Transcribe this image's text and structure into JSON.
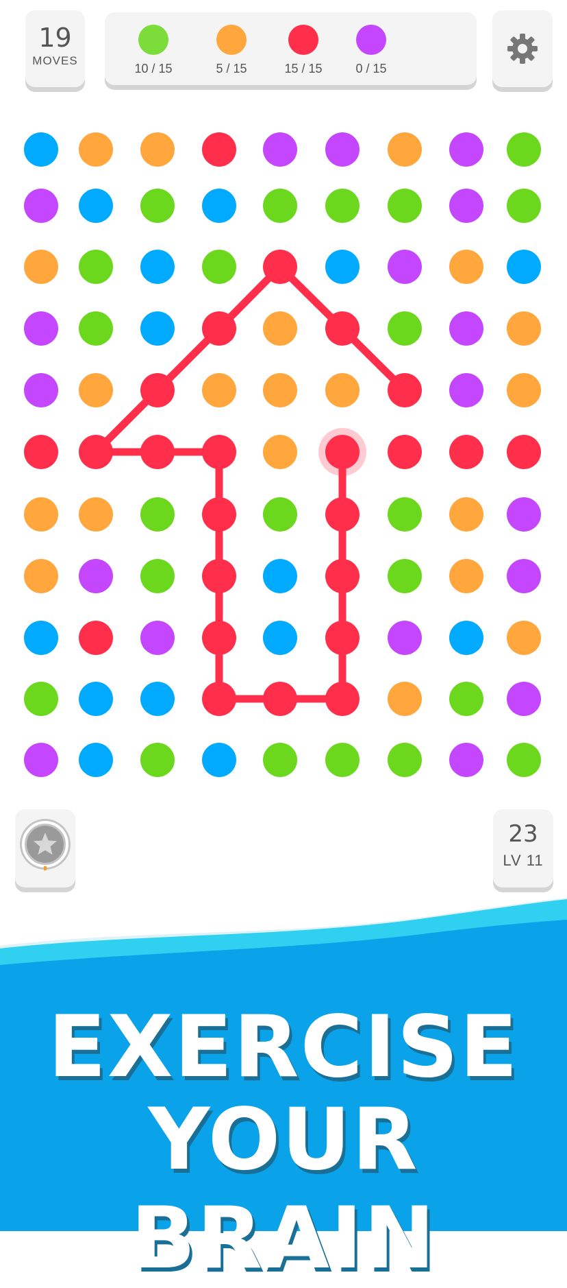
{
  "hud": {
    "moves": {
      "value": "19",
      "label": "MOVES"
    },
    "goals": [
      {
        "color": "#7bdc3a",
        "count": "10 / 15"
      },
      {
        "color": "#ffa63d",
        "count": "5 / 15"
      },
      {
        "color": "#ff2e4a",
        "count": "15 / 15"
      },
      {
        "color": "#c446ff",
        "count": "0 / 15"
      }
    ],
    "settings_icon": "gear-icon"
  },
  "board": {
    "colors": {
      "B": "#00aaff",
      "O": "#ffa63d",
      "R": "#ff2e4a",
      "P": "#c446ff",
      "G": "#6bd81e"
    },
    "grid": [
      [
        "B",
        "O",
        "O",
        "R",
        "P",
        "P",
        "O",
        "P",
        "G"
      ],
      [
        "P",
        "B",
        "G",
        "B",
        "G",
        "G",
        "G",
        "P",
        "G"
      ],
      [
        "O",
        "G",
        "B",
        "G",
        "R",
        "B",
        "P",
        "O",
        "B"
      ],
      [
        "P",
        "G",
        "B",
        "R",
        "O",
        "R",
        "G",
        "P",
        "O"
      ],
      [
        "P",
        "O",
        "R",
        "O",
        "O",
        "O",
        "R",
        "P",
        "O"
      ],
      [
        "R",
        "R",
        "R",
        "R",
        "O",
        "R",
        "R",
        "R",
        "R"
      ],
      [
        "O",
        "O",
        "G",
        "R",
        "G",
        "R",
        "G",
        "O",
        "P"
      ],
      [
        "O",
        "P",
        "G",
        "R",
        "B",
        "R",
        "G",
        "O",
        "P"
      ],
      [
        "B",
        "R",
        "P",
        "R",
        "B",
        "R",
        "P",
        "B",
        "O"
      ],
      [
        "G",
        "B",
        "B",
        "R",
        "R",
        "R",
        "O",
        "G",
        "P"
      ],
      [
        "P",
        "B",
        "G",
        "B",
        "G",
        "G",
        "G",
        "P",
        "G"
      ]
    ],
    "path": [
      [
        5,
        5
      ],
      [
        6,
        5
      ],
      [
        7,
        5
      ],
      [
        8,
        5
      ],
      [
        9,
        5
      ],
      [
        9,
        4
      ],
      [
        9,
        3
      ],
      [
        8,
        3
      ],
      [
        7,
        3
      ],
      [
        6,
        3
      ],
      [
        5,
        3
      ],
      [
        5,
        2
      ],
      [
        5,
        1
      ],
      [
        4,
        2
      ],
      [
        3,
        3
      ],
      [
        2,
        4
      ],
      [
        3,
        5
      ],
      [
        4,
        6
      ]
    ],
    "selected_dot": [
      5,
      5
    ],
    "path_color": "#ff2e4a"
  },
  "footer": {
    "star_icon": "star-icon",
    "level_number": "23",
    "level_label": "LV 11"
  },
  "promo": {
    "line1": "EXERCISE",
    "line2": "YOUR BRAIN",
    "colors": {
      "wave_light": "#2fd0f0",
      "wave_dark": "#0aa3ea"
    }
  }
}
